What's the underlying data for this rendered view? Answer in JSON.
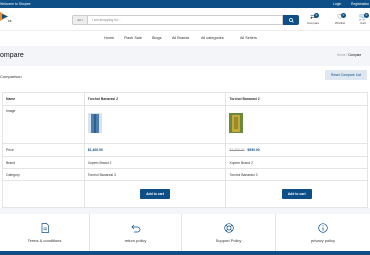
{
  "topbar": {
    "welcome": "Welcome to Shopee",
    "login": "Login",
    "register": "Registration"
  },
  "header": {
    "logo_text": "ex",
    "category_select": "All",
    "search_placeholder": "I am shopping for...",
    "compare": {
      "label": "Compare",
      "count": "0"
    },
    "wishlist": {
      "label": "Wishlist",
      "count": "0"
    },
    "cart": {
      "label": "Cart",
      "count": "0"
    }
  },
  "nav": [
    "Home",
    "Flash Sale",
    "Blogs",
    "All Brands",
    "All categories",
    "All Sellers"
  ],
  "page": {
    "title": "ompare",
    "breadcrumb_home": "Home",
    "breadcrumb_sep": "/",
    "breadcrumb_current": "Compare"
  },
  "card": {
    "title": "Comparison",
    "reset_label": "Reset Compare List"
  },
  "table": {
    "labels": {
      "name": "Name",
      "image": "Image",
      "price": "Price",
      "brand": "Brand",
      "category": "Category"
    },
    "products": [
      {
        "name": "Torchol Banarasi 2",
        "price": "$1,400.00",
        "old_price": "",
        "brand": "Xopem Brand 2",
        "category": "Torchol Banarasi 3",
        "cart_label": "Add to cart",
        "image_color": "#4a7fb0"
      },
      {
        "name": "Torchol Banarasi 2",
        "price": "$950.00",
        "old_price": "$1,400.00",
        "brand": "Xopem Brand 2",
        "category": "Torchol Banarasi 3",
        "cart_label": "Add to cart",
        "image_color": "#9a8a2a"
      }
    ]
  },
  "footer": [
    {
      "label": "Terms & conditions",
      "icon": "document-icon"
    },
    {
      "label": "return policy",
      "icon": "return-icon"
    },
    {
      "label": "Support Policy",
      "icon": "support-icon"
    },
    {
      "label": "privacy policy",
      "icon": "privacy-icon"
    }
  ],
  "colors": {
    "brand": "#0d4f86",
    "background": "#f4f5f8"
  }
}
